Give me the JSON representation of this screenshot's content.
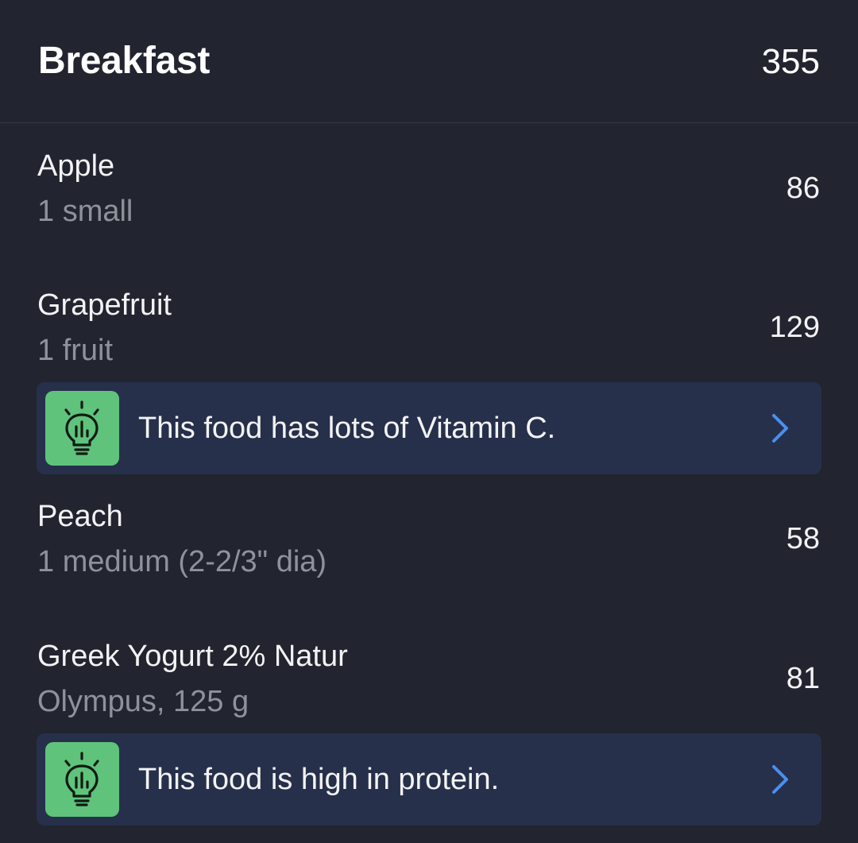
{
  "meal": {
    "title": "Breakfast",
    "total_calories": "355"
  },
  "foods": [
    {
      "name": "Apple",
      "serving": "1 small",
      "calories": "86"
    },
    {
      "name": "Grapefruit",
      "serving": "1 fruit",
      "calories": "129",
      "tip": "This food has lots of Vitamin C."
    },
    {
      "name": "Peach",
      "serving": "1 medium (2-2/3\" dia)",
      "calories": "58"
    },
    {
      "name": "Greek Yogurt 2% Natur",
      "serving": "Olympus, 125 g",
      "calories": "81",
      "tip": "This food is high in protein."
    }
  ],
  "icons": {
    "tip_icon": "lightbulb-chart-icon",
    "tip_chevron": "chevron-right-icon"
  },
  "colors": {
    "background": "#22242f",
    "tip_card": "#26304a",
    "tip_icon_bg": "#5fc37c",
    "accent_chevron": "#4a8ff0",
    "secondary_text": "#8f919b"
  }
}
